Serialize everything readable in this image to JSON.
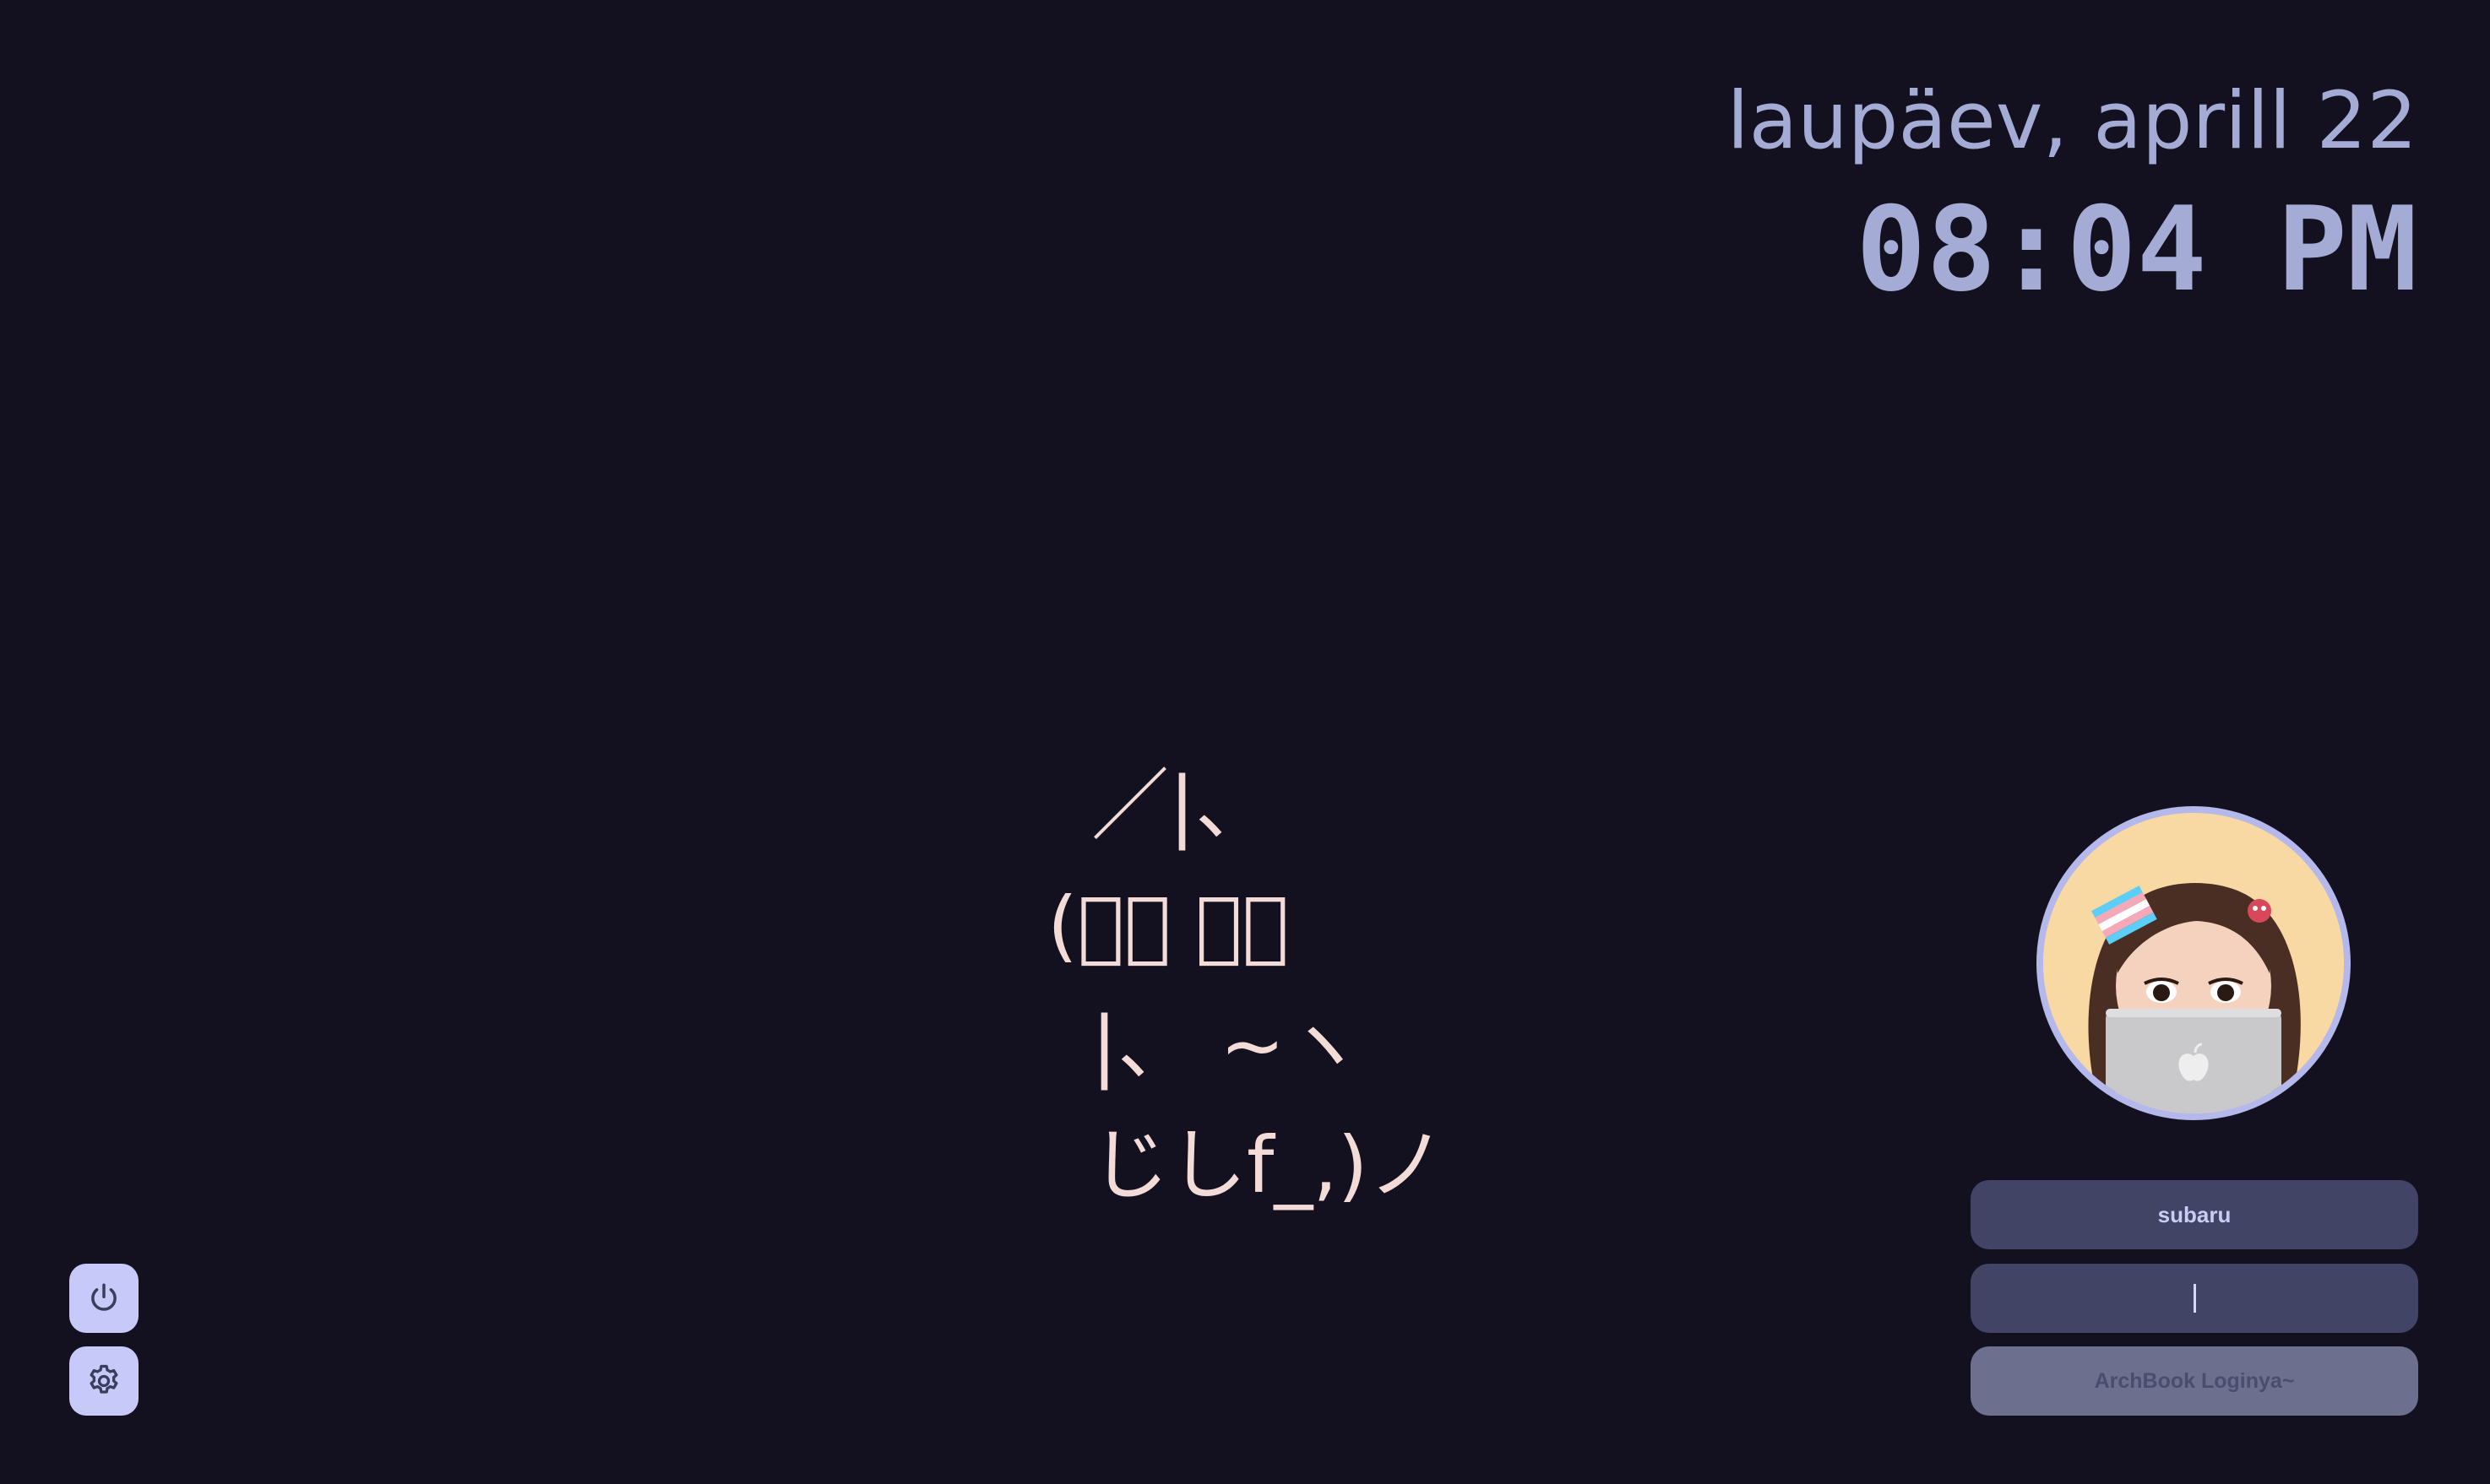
{
  "clock": {
    "date": "laupäev, aprill 22",
    "time": "08:04 PM"
  },
  "ascii_art": {
    "lines": [
      "／|、",
      "(ﾟ、 。７",
      "|、 ~ヽ",
      "じしf_,)ノ"
    ]
  },
  "login": {
    "avatar_icon": "memoji-avatar",
    "username": "subaru",
    "password_value": "",
    "login_button_label": "ArchBook Loginya~"
  },
  "actions": {
    "power_icon": "power-icon",
    "settings_icon": "gear-icon"
  },
  "colors": {
    "background": "#13111f",
    "clock_text": "#a4acd6",
    "art_text": "#f3dcd8",
    "field_bg": "#414465",
    "button_disabled_bg": "#6c6f8e",
    "accent": "#c7c9f8"
  }
}
